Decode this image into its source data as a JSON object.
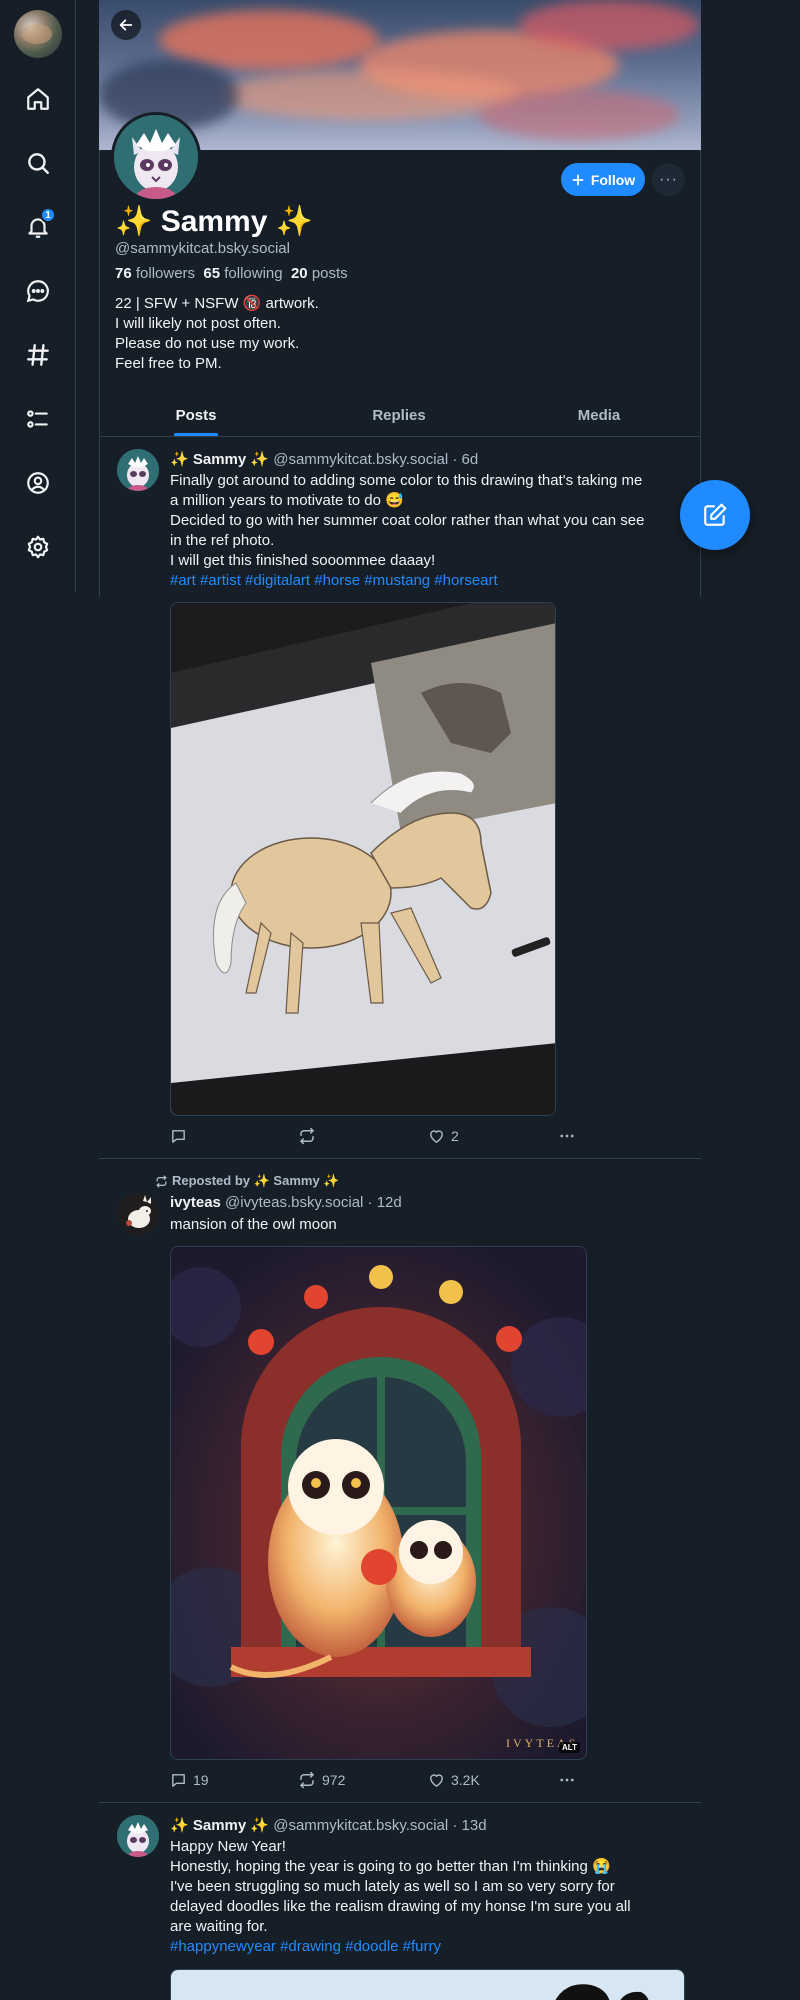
{
  "nav": {
    "notification_count": "1",
    "icons": [
      "home-icon",
      "search-icon",
      "bell-icon",
      "chat-icon",
      "hashtag-icon",
      "feeds-icon",
      "profile-icon",
      "gear-icon"
    ]
  },
  "profile": {
    "display_name": "✨ Sammy ✨",
    "handle": "@sammykitcat.bsky.social",
    "followers_count": "76",
    "followers_label": "followers",
    "following_count": "65",
    "following_label": "following",
    "posts_count": "20",
    "posts_label": "posts",
    "bio": [
      "22 | SFW + NSFW 🔞 artwork.",
      "I will likely not post often.",
      "Please do not use my work.",
      "Feel free to PM."
    ],
    "follow_label": "Follow",
    "more_label": "···"
  },
  "tabs": [
    "Posts",
    "Replies",
    "Media"
  ],
  "posts": [
    {
      "name": "✨ Sammy ✨",
      "handle": "@sammykitcat.bsky.social",
      "time": "· 6d",
      "lines": [
        "Finally got around to adding some color to this drawing that's taking me",
        "a million years to motivate to do 😅",
        "Decided to go with her summer coat color rather than what you can see",
        "in the ref photo.",
        "I will get this finished sooommee daaay!"
      ],
      "tags": "#art #artist #digitalart #horse #mustang #horseart",
      "replies": "",
      "reposts": "",
      "likes": "2"
    },
    {
      "reposted_by": "Reposted by ✨ Sammy ✨",
      "name": "ivyteas",
      "handle": "@ivyteas.bsky.social",
      "time": "· 12d",
      "lines": [
        "mansion of the owl moon"
      ],
      "watermark": "IVYTEAS",
      "alt": "ALT",
      "replies": "19",
      "reposts": "972",
      "likes": "3.2K"
    },
    {
      "name": "✨ Sammy ✨",
      "handle": "@sammykitcat.bsky.social",
      "time": "· 13d",
      "lines": [
        "Happy New Year!",
        "Honestly, hoping the year is going to go better than I'm thinking 😭",
        "I've been struggling so much lately as well so I am so very sorry for",
        "delayed doodles like the realism drawing of my honse I'm sure you all",
        "are waiting for."
      ],
      "tags": "#happynewyear #drawing #doodle #furry"
    }
  ],
  "colors": {
    "accent": "#208bfe",
    "bg": "#161e27",
    "border": "#2e4052",
    "muted": "#aebbc9"
  }
}
